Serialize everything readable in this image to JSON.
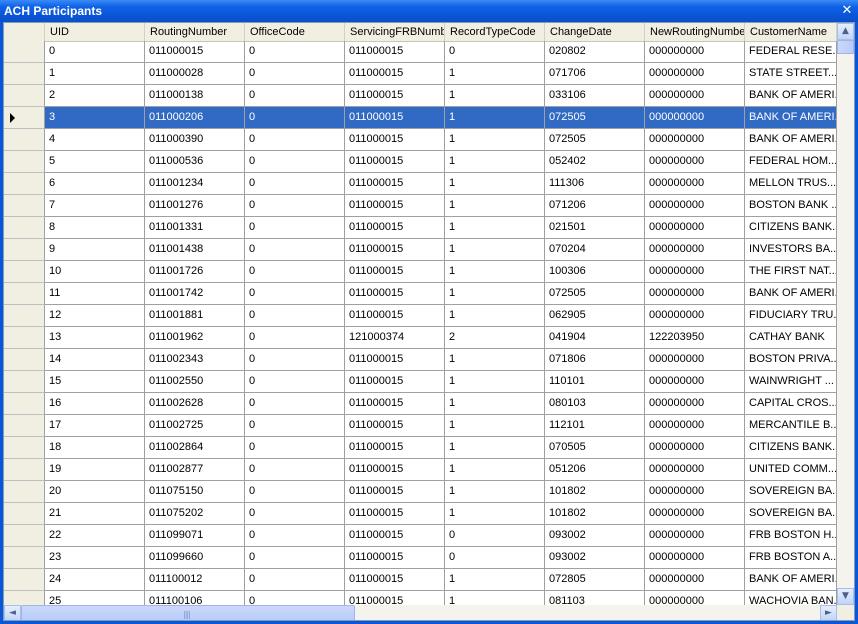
{
  "window": {
    "title": "ACH Participants",
    "close_glyph": "✕"
  },
  "columns": [
    "UID",
    "RoutingNumber",
    "OfficeCode",
    "ServicingFRBNumb",
    "RecordTypeCode",
    "ChangeDate",
    "NewRoutingNumbe",
    "CustomerName"
  ],
  "selected_row": 3,
  "rows": [
    [
      "0",
      "011000015",
      "0",
      "011000015",
      "0",
      "020802",
      "000000000",
      "FEDERAL RESE..."
    ],
    [
      "1",
      "011000028",
      "0",
      "011000015",
      "1",
      "071706",
      "000000000",
      "STATE STREET..."
    ],
    [
      "2",
      "011000138",
      "0",
      "011000015",
      "1",
      "033106",
      "000000000",
      "BANK OF AMERI..."
    ],
    [
      "3",
      "011000206",
      "0",
      "011000015",
      "1",
      "072505",
      "000000000",
      "BANK OF AMERI..."
    ],
    [
      "4",
      "011000390",
      "0",
      "011000015",
      "1",
      "072505",
      "000000000",
      "BANK OF AMERI..."
    ],
    [
      "5",
      "011000536",
      "0",
      "011000015",
      "1",
      "052402",
      "000000000",
      "FEDERAL HOM..."
    ],
    [
      "6",
      "011001234",
      "0",
      "011000015",
      "1",
      "111306",
      "000000000",
      "MELLON TRUS..."
    ],
    [
      "7",
      "011001276",
      "0",
      "011000015",
      "1",
      "071206",
      "000000000",
      "BOSTON BANK ..."
    ],
    [
      "8",
      "011001331",
      "0",
      "011000015",
      "1",
      "021501",
      "000000000",
      "CITIZENS BANK..."
    ],
    [
      "9",
      "011001438",
      "0",
      "011000015",
      "1",
      "070204",
      "000000000",
      "INVESTORS BA..."
    ],
    [
      "10",
      "011001726",
      "0",
      "011000015",
      "1",
      "100306",
      "000000000",
      "THE FIRST NAT..."
    ],
    [
      "11",
      "011001742",
      "0",
      "011000015",
      "1",
      "072505",
      "000000000",
      "BANK OF AMERI..."
    ],
    [
      "12",
      "011001881",
      "0",
      "011000015",
      "1",
      "062905",
      "000000000",
      "FIDUCIARY TRU..."
    ],
    [
      "13",
      "011001962",
      "0",
      "121000374",
      "2",
      "041904",
      "122203950",
      "CATHAY BANK"
    ],
    [
      "14",
      "011002343",
      "0",
      "011000015",
      "1",
      "071806",
      "000000000",
      "BOSTON PRIVA..."
    ],
    [
      "15",
      "011002550",
      "0",
      "011000015",
      "1",
      "110101",
      "000000000",
      "WAINWRIGHT ..."
    ],
    [
      "16",
      "011002628",
      "0",
      "011000015",
      "1",
      "080103",
      "000000000",
      "CAPITAL CROS..."
    ],
    [
      "17",
      "011002725",
      "0",
      "011000015",
      "1",
      "112101",
      "000000000",
      "MERCANTILE B..."
    ],
    [
      "18",
      "011002864",
      "0",
      "011000015",
      "1",
      "070505",
      "000000000",
      "CITIZENS BANK..."
    ],
    [
      "19",
      "011002877",
      "0",
      "011000015",
      "1",
      "051206",
      "000000000",
      "UNITED COMM..."
    ],
    [
      "20",
      "011075150",
      "0",
      "011000015",
      "1",
      "101802",
      "000000000",
      "SOVEREIGN BA..."
    ],
    [
      "21",
      "011075202",
      "0",
      "011000015",
      "1",
      "101802",
      "000000000",
      "SOVEREIGN BA..."
    ],
    [
      "22",
      "011099071",
      "0",
      "011000015",
      "0",
      "093002",
      "000000000",
      "FRB BOSTON H..."
    ],
    [
      "23",
      "011099660",
      "0",
      "011000015",
      "0",
      "093002",
      "000000000",
      "FRB BOSTON A..."
    ],
    [
      "24",
      "011100012",
      "0",
      "011000015",
      "1",
      "072805",
      "000000000",
      "BANK OF AMERI..."
    ],
    [
      "25",
      "011100106",
      "0",
      "011000015",
      "1",
      "081103",
      "000000000",
      "WACHOVIA BAN..."
    ]
  ],
  "scrollbars": {
    "up": "▲",
    "down": "▼",
    "left": "◄",
    "right": "►",
    "grip": "||||"
  }
}
